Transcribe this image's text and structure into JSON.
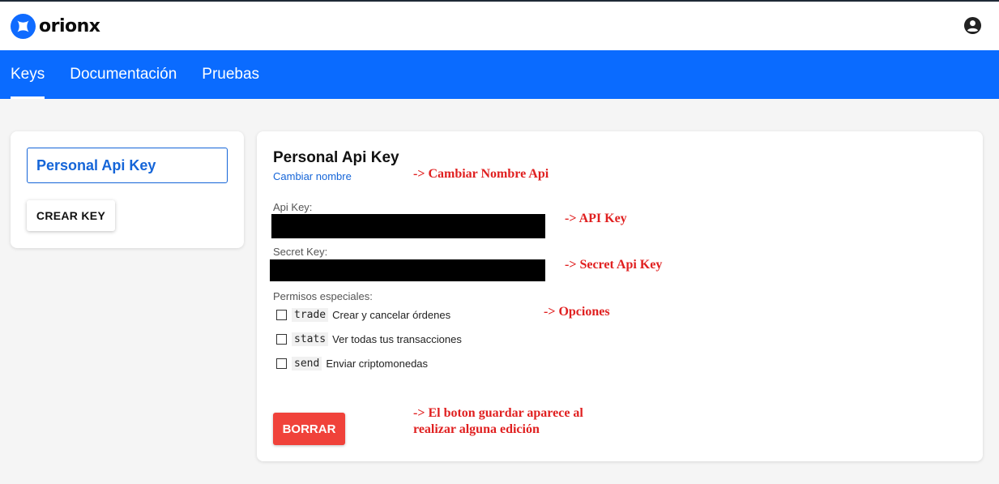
{
  "app": {
    "logo_text": "orionx"
  },
  "nav": {
    "tabs": [
      {
        "label": "Keys",
        "active": true
      },
      {
        "label": "Documentación",
        "active": false
      },
      {
        "label": "Pruebas",
        "active": false
      }
    ]
  },
  "sidebar": {
    "key_name": "Personal Api Key",
    "create_label": "CREAR KEY"
  },
  "detail": {
    "title": "Personal Api Key",
    "rename_link": "Cambiar nombre",
    "api_key_label": "Api Key:",
    "secret_key_label": "Secret Key:",
    "permissions_label": "Permisos especiales:",
    "permissions": [
      {
        "code": "trade",
        "description": "Crear y cancelar órdenes",
        "checked": false
      },
      {
        "code": "stats",
        "description": "Ver todas tus transacciones",
        "checked": false
      },
      {
        "code": "send",
        "description": "Enviar criptomonedas",
        "checked": false
      }
    ],
    "delete_label": "BORRAR"
  },
  "annotations": {
    "rename": "-> Cambiar Nombre Api",
    "api_key": "-> API Key",
    "secret_key": "-> Secret Api Key",
    "options": "-> Opciones",
    "save_line1": "-> El boton guardar aparece al",
    "save_line2": "realizar alguna edición"
  },
  "colors": {
    "brand_blue": "#0a6bff",
    "link_blue": "#1565d8",
    "danger": "#f0423a",
    "annotation_red": "#e02020"
  },
  "icons": {
    "logo": "orionx-star-logo-icon",
    "account": "account-circle-icon"
  }
}
